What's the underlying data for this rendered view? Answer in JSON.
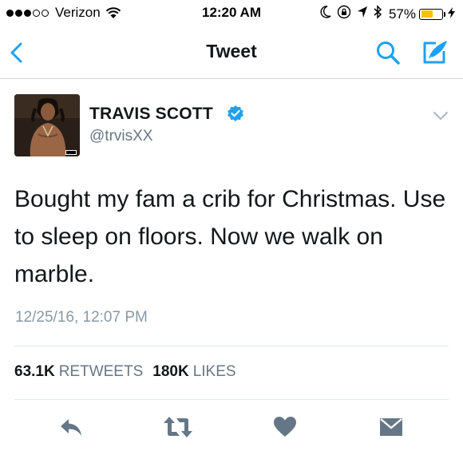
{
  "status_bar": {
    "carrier": "Verizon",
    "time": "12:20 AM",
    "battery_percent": "57%",
    "battery_level": 0.57,
    "battery_color": "#f5c400",
    "signal_bars_filled": 3,
    "signal_bars_total": 5,
    "icons": [
      "wifi-icon",
      "moon-icon",
      "orientation-lock-icon",
      "location-arrow-icon",
      "bluetooth-icon",
      "charging-bolt-icon"
    ]
  },
  "nav": {
    "title": "Tweet",
    "back_icon": "chevron-left-icon",
    "search_icon": "search-icon",
    "compose_icon": "compose-icon",
    "accent_color": "#1da1f2"
  },
  "tweet": {
    "author_name": "TRAVIS SCOTT",
    "handle": "@trvisXX",
    "verified": true,
    "text": "Bought my fam a crib for Christmas. Use to sleep on floors. Now we walk on marble.",
    "timestamp": "12/25/16, 12:07 PM",
    "retweet_count": "63.1K",
    "retweet_label": "RETWEETS",
    "like_count": "180K",
    "like_label": "LIKES"
  },
  "actions": [
    {
      "name": "reply",
      "icon": "reply-icon"
    },
    {
      "name": "retweet",
      "icon": "retweet-icon"
    },
    {
      "name": "like",
      "icon": "heart-icon"
    },
    {
      "name": "direct-message",
      "icon": "envelope-icon"
    }
  ],
  "colors": {
    "action_icon": "#657786",
    "secondary_text": "#657786",
    "timestamp_text": "#8899a6"
  }
}
